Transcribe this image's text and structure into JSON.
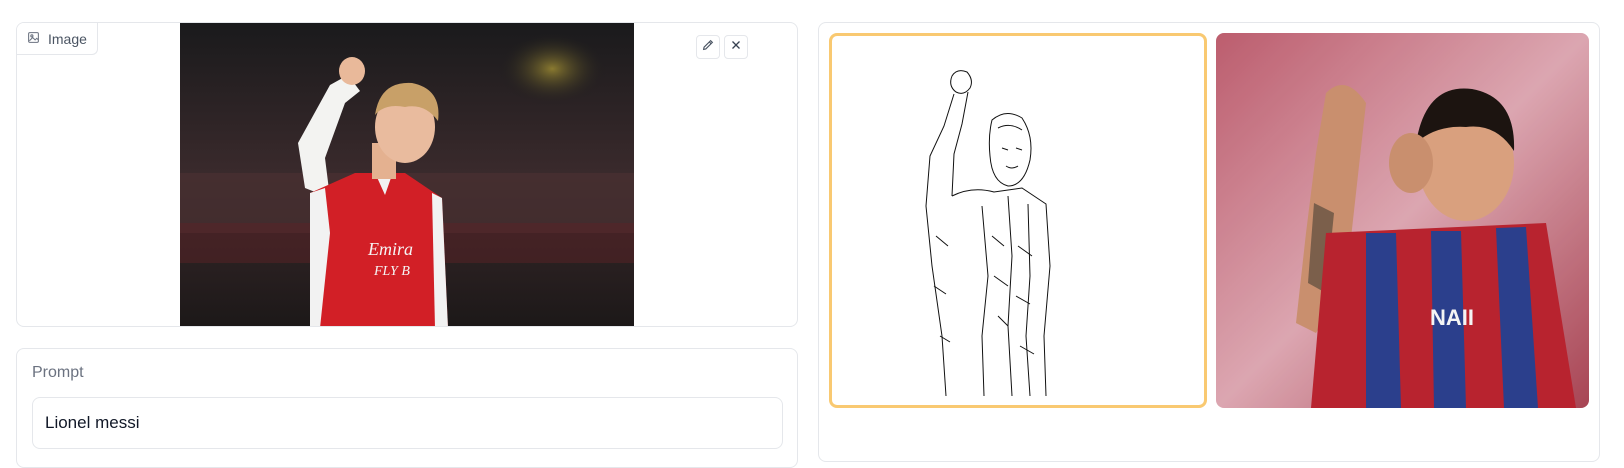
{
  "image_input": {
    "label": "Image",
    "icon": "image-icon",
    "edit_icon": "pencil-icon",
    "close_icon": "close-icon"
  },
  "prompt": {
    "label": "Prompt",
    "value": "Lionel messi"
  },
  "gallery": {
    "selected_index": 0,
    "accent_color": "#f9c971"
  },
  "colors": {
    "border": "#e5e7eb",
    "label_text": "#6b7280"
  }
}
